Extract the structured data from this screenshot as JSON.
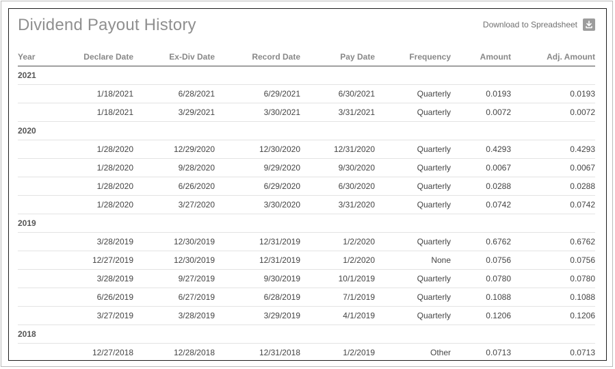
{
  "page": {
    "title": "Dividend Payout History",
    "download_label": "Download to Spreadsheet"
  },
  "table": {
    "headers": [
      "Year",
      "Declare Date",
      "Ex-Div Date",
      "Record Date",
      "Pay Date",
      "Frequency",
      "Amount",
      "Adj. Amount"
    ],
    "groups": [
      {
        "year": "2021",
        "rows": [
          [
            "1/18/2021",
            "6/28/2021",
            "6/29/2021",
            "6/30/2021",
            "Quarterly",
            "0.0193",
            "0.0193"
          ],
          [
            "1/18/2021",
            "3/29/2021",
            "3/30/2021",
            "3/31/2021",
            "Quarterly",
            "0.0072",
            "0.0072"
          ]
        ]
      },
      {
        "year": "2020",
        "rows": [
          [
            "1/28/2020",
            "12/29/2020",
            "12/30/2020",
            "12/31/2020",
            "Quarterly",
            "0.4293",
            "0.4293"
          ],
          [
            "1/28/2020",
            "9/28/2020",
            "9/29/2020",
            "9/30/2020",
            "Quarterly",
            "0.0067",
            "0.0067"
          ],
          [
            "1/28/2020",
            "6/26/2020",
            "6/29/2020",
            "6/30/2020",
            "Quarterly",
            "0.0288",
            "0.0288"
          ],
          [
            "1/28/2020",
            "3/27/2020",
            "3/30/2020",
            "3/31/2020",
            "Quarterly",
            "0.0742",
            "0.0742"
          ]
        ]
      },
      {
        "year": "2019",
        "rows": [
          [
            "3/28/2019",
            "12/30/2019",
            "12/31/2019",
            "1/2/2020",
            "Quarterly",
            "0.6762",
            "0.6762"
          ],
          [
            "12/27/2019",
            "12/30/2019",
            "12/31/2019",
            "1/2/2020",
            "None",
            "0.0756",
            "0.0756"
          ],
          [
            "3/28/2019",
            "9/27/2019",
            "9/30/2019",
            "10/1/2019",
            "Quarterly",
            "0.0780",
            "0.0780"
          ],
          [
            "6/26/2019",
            "6/27/2019",
            "6/28/2019",
            "7/1/2019",
            "Quarterly",
            "0.1088",
            "0.1088"
          ],
          [
            "3/27/2019",
            "3/28/2019",
            "3/29/2019",
            "4/1/2019",
            "Quarterly",
            "0.1206",
            "0.1206"
          ]
        ]
      },
      {
        "year": "2018",
        "rows": [
          [
            "12/27/2018",
            "12/28/2018",
            "12/31/2018",
            "1/2/2019",
            "Other",
            "0.0713",
            "0.0713"
          ]
        ]
      }
    ]
  },
  "icons": {
    "download": "download-icon"
  },
  "colors": {
    "title": "#8f8f8f",
    "header_text": "#888888",
    "row_text": "#444444",
    "icon_bg": "#9c9c9c"
  }
}
